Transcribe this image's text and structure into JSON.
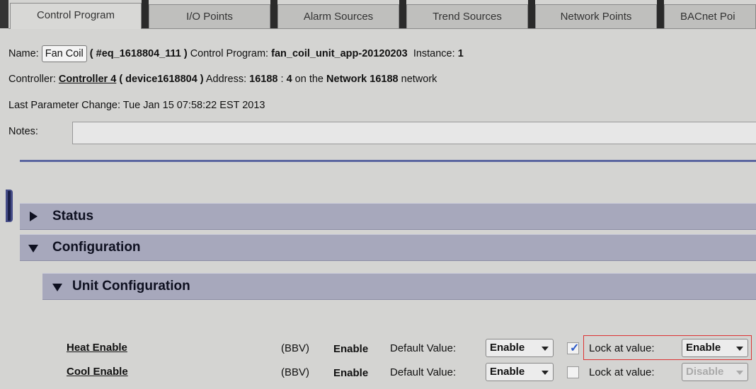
{
  "tabs": [
    {
      "label": "Control Program",
      "active": true
    },
    {
      "label": "I/O Points",
      "active": false
    },
    {
      "label": "Alarm Sources",
      "active": false
    },
    {
      "label": "Trend Sources",
      "active": false
    },
    {
      "label": "Network Points",
      "active": false
    },
    {
      "label": "BACnet Poi",
      "active": false
    }
  ],
  "info": {
    "name_label": "Name:",
    "name_value": "Fan Coil",
    "equip_id": "( #eq_1618804_111 )",
    "program_label": "Control Program:",
    "program_value": "fan_coil_unit_app-20120203",
    "instance_label": "Instance:",
    "instance_value": "1",
    "controller_label": "Controller:",
    "controller_value": "Controller 4",
    "device_id": "( device1618804 )",
    "address_label": "Address:",
    "address_value": "16188",
    "address_sep": ":",
    "address_node": "4",
    "network_pre": "on the",
    "network_value": "Network 16188",
    "network_post": "network",
    "last_change_label": "Last Parameter Change:",
    "last_change_value": "Tue Jan 15 07:58:22 EST 2013",
    "notes_label": "Notes:",
    "notes_value": ""
  },
  "sections": {
    "status": "Status",
    "configuration": "Configuration",
    "unit_configuration": "Unit Configuration"
  },
  "params": [
    {
      "label": "Heat Enable",
      "type": "(BBV)",
      "value": "Enable",
      "default_label": "Default Value:",
      "default_value": "Enable",
      "lock_checked": true,
      "lock_label": "Lock at value:",
      "lock_value": "Enable",
      "lock_disabled": false
    },
    {
      "label": "Cool Enable",
      "type": "(BBV)",
      "value": "Enable",
      "default_label": "Default Value:",
      "default_value": "Enable",
      "lock_checked": false,
      "lock_label": "Lock at value:",
      "lock_value": "Disable",
      "lock_disabled": true
    }
  ],
  "colors": {
    "section_bar": "#a7a8bc",
    "divider": "#5b66a0",
    "highlight_box": "#dd3333",
    "checkmark": "#2a58c8"
  }
}
